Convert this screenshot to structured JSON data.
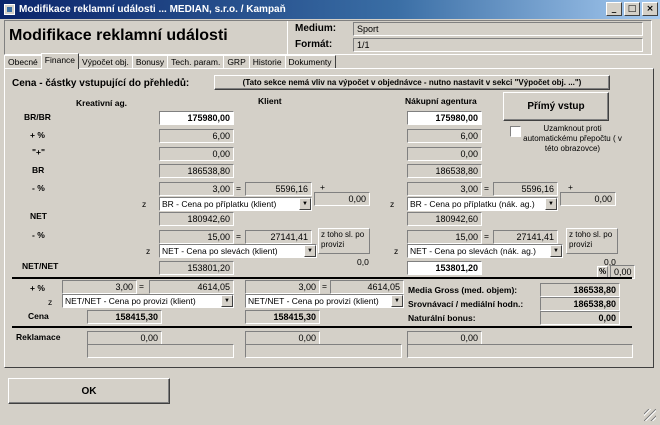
{
  "window": {
    "title": "Modifikace reklamní události ... MEDIAN, s.r.o. / Kampaň",
    "min": "_",
    "max": "□",
    "close": "×"
  },
  "header": {
    "title": "Modifikace reklamní události",
    "medium_label": "Medium:",
    "medium_value": "Sport",
    "format_label": "Formát:",
    "format_value": "1/1"
  },
  "tabs": [
    "Obecné",
    "Finance",
    "Výpočet obj.",
    "Bonusy",
    "Tech. param.",
    "GRP",
    "Historie",
    "Dokumenty"
  ],
  "section": {
    "title": "Cena - částky vstupující do přehledů:",
    "note": "(Tato sekce nemá vliv na výpočet v objednávce - nutno nastavit v sekci \"Výpočet obj. ...\")"
  },
  "columns": {
    "kreativni": "Kreativní ag.",
    "klient": "Klient",
    "nakupni": "Nákupní agentura"
  },
  "rows": {
    "brbr": "BR/BR",
    "plus1": "+ %",
    "quote": "\"+\"",
    "br": "BR",
    "minus1": "- %",
    "net": "NET",
    "minus2": "- %",
    "netnet": "NET/NET",
    "plus2": "+ %",
    "cena": "Cena",
    "reklamace": "Reklamace"
  },
  "z": "z",
  "eq": "=",
  "plus": "+",
  "klient": {
    "brbr": "175980,00",
    "plus_pct": "6,00",
    "quote": "0,00",
    "br": "186538,80",
    "minus1_pct": "3,00",
    "minus1_val": "5596,16",
    "extra1": "0,00",
    "dd1": "BR - Cena po příplatku (klient)",
    "net": "180942,60",
    "minus2_pct": "15,00",
    "minus2_val": "27141,41",
    "note": "z toho sl. po provizi",
    "note_val": "0,0",
    "dd2": "NET - Cena po slevách (klient)",
    "netnet": "153801,20"
  },
  "nakupni": {
    "brbr": "175980,00",
    "plus_pct": "6,00",
    "quote": "0,00",
    "br": "186538,80",
    "minus1_pct": "3,00",
    "minus1_val": "5596,16",
    "extra1": "0,00",
    "dd1": "BR - Cena po příplatku (nák. ag.)",
    "net": "180942,60",
    "minus2_pct": "15,00",
    "minus2_val": "27141,41",
    "note": "z toho sl. po provizi",
    "note_val": "0,0",
    "dd2": "NET - Cena po slevách (nák. ag.)",
    "netnet": "153801,20",
    "pct_label": "%",
    "pct_val": "0,00"
  },
  "prime_button": "Přímý vstup",
  "lock_label": "Uzamknout proti automatickému přepočtu ( v této obrazovce)",
  "bottom": {
    "k_pct": "3,00",
    "k_val": "4614,05",
    "k_dd": "NET/NET - Cena po provizi (klient)",
    "k_cena": "158415,30",
    "c_pct": "3,00",
    "c_val": "4614,05",
    "c_dd": "NET/NET - Cena po provizi (klient)",
    "c_cena": "158415,30",
    "rek1": "0,00",
    "rek2": "0,00",
    "rek3": "0,00"
  },
  "summary": {
    "gross_label": "Media Gross (med. objem):",
    "gross": "186538,80",
    "srov_label": "Srovnávací / mediální hodn.:",
    "srov": "186538,80",
    "nat_label": "Naturální bonus:",
    "nat": "0,00"
  },
  "ok": "OK"
}
